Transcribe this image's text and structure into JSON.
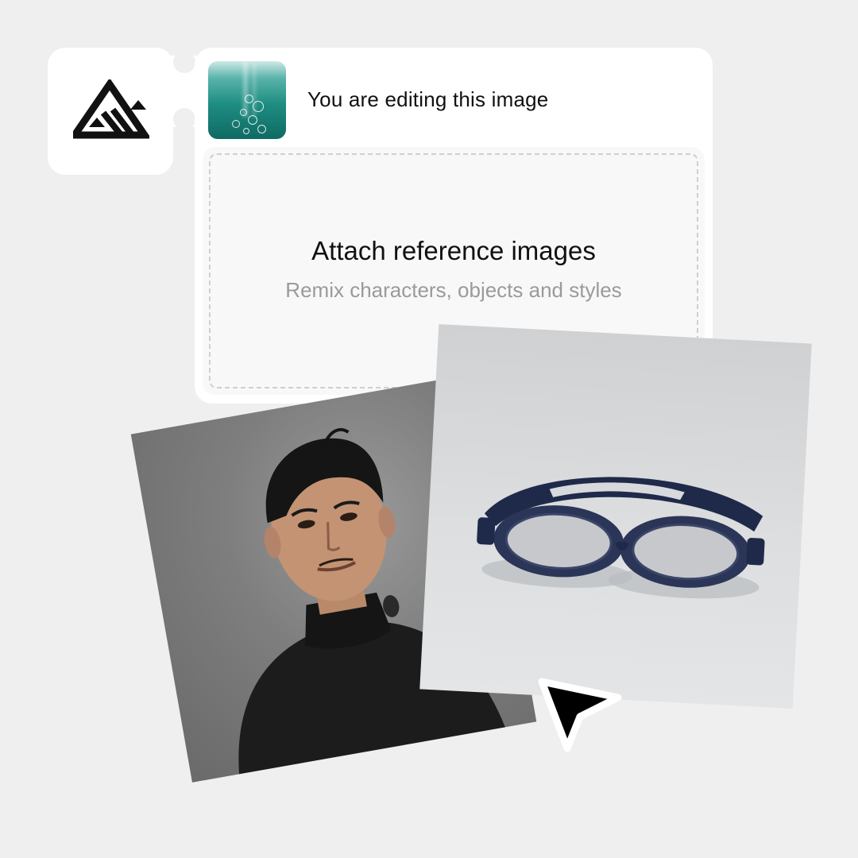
{
  "editor": {
    "title": "You are editing this image",
    "current_image": "underwater-bubbles"
  },
  "dropzone": {
    "title": "Attach reference images",
    "subtitle": "Remix characters, objects and styles"
  },
  "references": [
    {
      "subject": "man-in-wetsuit"
    },
    {
      "subject": "swim-goggles"
    }
  ],
  "colors": {
    "background": "#efefef",
    "card": "#ffffff",
    "dropzone": "#f8f8f8",
    "dash": "#cfcfcf",
    "subtitle": "#9a9a9a",
    "goggles": "#1f2a4a"
  }
}
